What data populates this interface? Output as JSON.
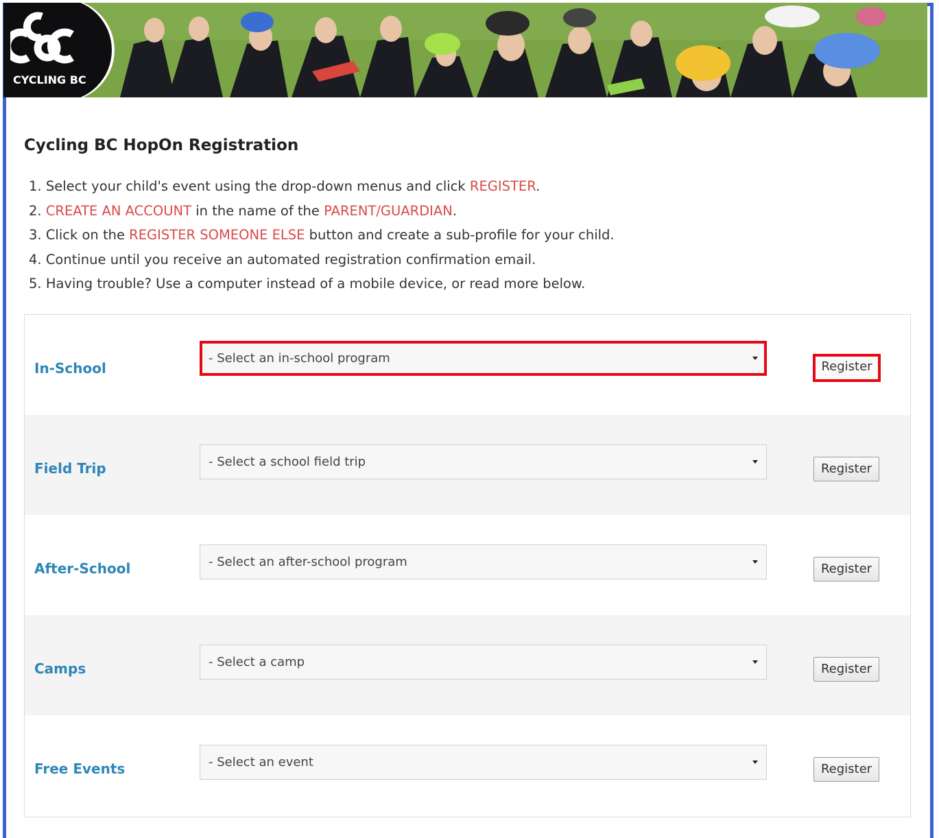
{
  "brand": {
    "logo_text": "CYCLING BC"
  },
  "page": {
    "title": "Cycling BC HopOn Registration"
  },
  "steps": [
    {
      "n": "1.",
      "parts": [
        {
          "text": "Select your child's event using the drop-down menus and click ",
          "hl": false
        },
        {
          "text": "REGISTER",
          "hl": true
        },
        {
          "text": ".",
          "hl": false
        }
      ]
    },
    {
      "n": "2.",
      "parts": [
        {
          "text": "CREATE AN ACCOUNT",
          "hl": true
        },
        {
          "text": " in the name of the ",
          "hl": false
        },
        {
          "text": "PARENT/GUARDIAN",
          "hl": true
        },
        {
          "text": ".",
          "hl": false
        }
      ]
    },
    {
      "n": "3.",
      "parts": [
        {
          "text": "Click on the ",
          "hl": false
        },
        {
          "text": "REGISTER SOMEONE ELSE",
          "hl": true
        },
        {
          "text": " button and create a sub-profile for your child.",
          "hl": false
        }
      ]
    },
    {
      "n": "4.",
      "parts": [
        {
          "text": "Continue until you receive an automated registration confirmation email.",
          "hl": false
        }
      ]
    },
    {
      "n": "5.",
      "parts": [
        {
          "text": "Having trouble? Use a computer instead of a mobile device, or read more below.",
          "hl": false
        }
      ]
    }
  ],
  "programs": [
    {
      "label": "In-School",
      "select": "- Select an in-school program",
      "button": "Register"
    },
    {
      "label": "Field Trip",
      "select": "- Select a school field trip",
      "button": "Register"
    },
    {
      "label": "After-School",
      "select": "- Select an after-school program",
      "button": "Register"
    },
    {
      "label": "Camps",
      "select": "- Select a camp",
      "button": "Register"
    },
    {
      "label": "Free Events",
      "select": "- Select an event",
      "button": "Register"
    }
  ],
  "colors": {
    "frame": "#3b63d1",
    "highlight_text": "#d94a4a",
    "label": "#2e86b8",
    "annotation": "#e50914"
  },
  "icons": {
    "banner": "kids-on-bikes-photo",
    "dropdown": "caret-down-icon"
  }
}
